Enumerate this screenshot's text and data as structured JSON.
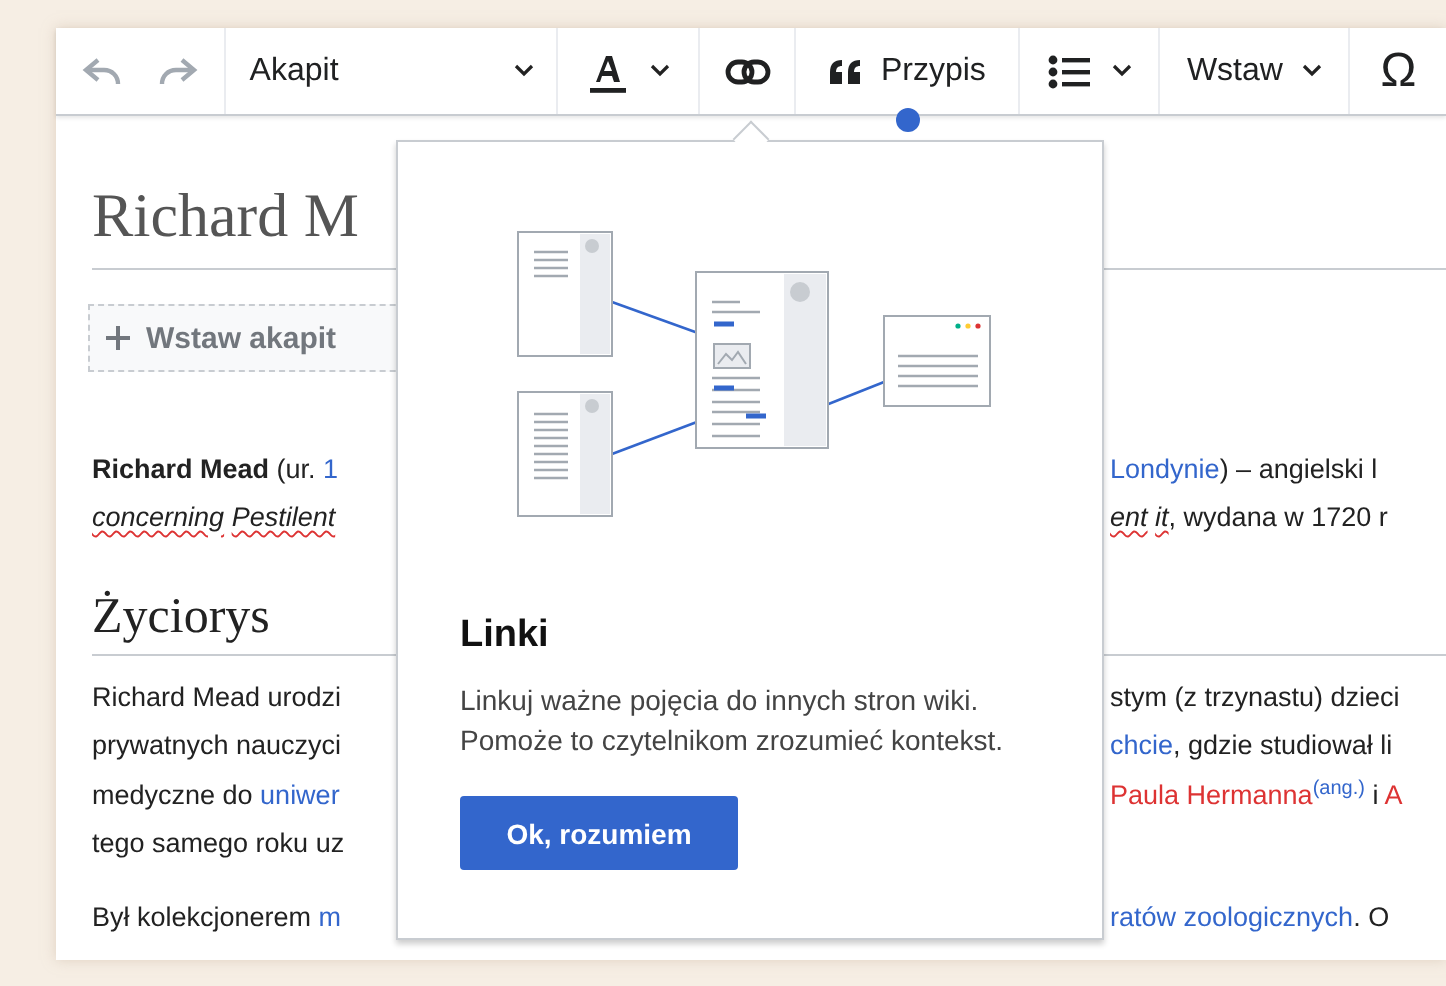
{
  "toolbar": [
    {
      "kind": "undo",
      "disabled": true
    },
    {
      "kind": "redo",
      "disabled": true
    },
    {
      "kind": "format",
      "label": "Akapit",
      "disabled": false
    },
    {
      "kind": "style",
      "disabled": false
    },
    {
      "kind": "link",
      "disabled": false
    },
    {
      "kind": "cite",
      "label": "Przypis",
      "disabled": false
    },
    {
      "kind": "list",
      "disabled": false
    },
    {
      "kind": "insert",
      "label": "Wstaw",
      "disabled": false
    },
    {
      "kind": "special",
      "label": "Ω",
      "disabled": false
    }
  ],
  "article": [
    {
      "kind": "title",
      "text": "Richard M"
    },
    {
      "kind": "insert-paragraph",
      "text": "Wstaw akapit"
    },
    {
      "kind": "paragraph",
      "lines": [
        {
          "left": [
            {
              "t": "Richard Mead",
              "kind": "bold"
            },
            {
              "t": " (ur. ",
              "kind": "plain"
            },
            {
              "t": "1",
              "kind": "link"
            }
          ],
          "right": [
            {
              "t": "Londynie",
              "kind": "link"
            },
            {
              "t": ") – angielski l",
              "kind": "plain"
            }
          ]
        },
        {
          "left": [
            {
              "t": "concerning",
              "kind": "misspelled"
            },
            {
              "t": "Pestilent",
              "kind": "misspelled"
            }
          ],
          "right": [
            {
              "t": "ent",
              "kind": "misspelled"
            },
            {
              "t": "it",
              "kind": "misspelled"
            },
            {
              "t": ", wydana w 1720 r",
              "kind": "plain"
            }
          ]
        }
      ]
    },
    {
      "kind": "heading",
      "text": "Życiorys"
    },
    {
      "kind": "paragraph",
      "lines": [
        {
          "left": [
            {
              "t": "Richard Mead urodzi",
              "kind": "plain"
            }
          ],
          "right": [
            {
              "t": "stym (z trzynastu) dzieci",
              "kind": "plain"
            }
          ]
        },
        {
          "left": [
            {
              "t": "prywatnych nauczyci",
              "kind": "plain"
            }
          ],
          "right": [
            {
              "t": "chcie",
              "kind": "link"
            },
            {
              "t": ", gdzie studiował li",
              "kind": "plain"
            }
          ]
        },
        {
          "left": [
            {
              "t": "medyczne do ",
              "kind": "plain"
            },
            {
              "t": "uniwer",
              "kind": "link"
            }
          ],
          "right": [
            {
              "t": "Paula Hermanna",
              "kind": "redlink"
            },
            {
              "t": "(ang.)",
              "kind": "sup"
            },
            {
              "t": " i ",
              "kind": "plain"
            },
            {
              "t": "A",
              "kind": "redlink"
            }
          ]
        },
        {
          "left": [
            {
              "t": "tego samego roku uz",
              "kind": "plain"
            }
          ]
        }
      ]
    },
    {
      "kind": "paragraph",
      "lines": [
        {
          "left": [
            {
              "t": "Był kolekcjonerem ",
              "kind": "plain"
            },
            {
              "t": "m",
              "kind": "link"
            }
          ],
          "right": [
            {
              "t": "ratów zoologicznych",
              "kind": "link"
            },
            {
              "t": ". O",
              "kind": "plain"
            }
          ]
        }
      ]
    }
  ],
  "popup": {
    "title": "Linki",
    "text": "Linkuj ważne pojęcia do innych stron wiki. Pomoże to czytelnikom zrozumieć kontekst.",
    "button": "Ok, rozumiem"
  }
}
